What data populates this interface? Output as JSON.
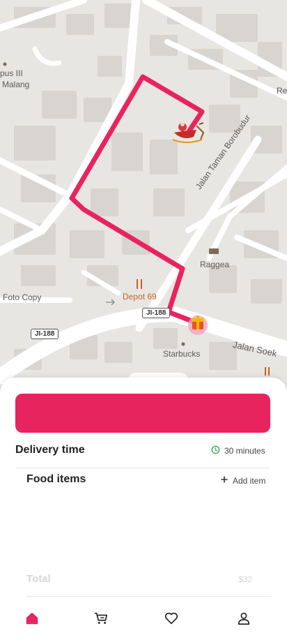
{
  "map": {
    "labels": {
      "campus": "pus III",
      "malang": "Malang",
      "re": "Re",
      "jalan_taman": "Jalan Taman Borobudur",
      "raggea": "Raggea",
      "foto_copy": "Foto Copy",
      "depot": "Depot 69",
      "jalan_soek": "Jalan Soek",
      "starbucks": "Starbucks",
      "road_badge_1": "JI-188",
      "road_badge_2": "JI-188"
    },
    "route_color": "#e8245f"
  },
  "sheet": {
    "primary_button_label": "",
    "delivery_time_label": "Delivery time",
    "delivery_time_value": "30 minutes",
    "food_items_label": "Food items",
    "add_item_label": "Add item",
    "total_label": "Total",
    "total_value": "$32"
  },
  "nav": {
    "items": [
      "home-icon",
      "cart-icon",
      "heart-icon",
      "profile-icon"
    ],
    "active": "home-icon",
    "accent": "#e8245f"
  }
}
